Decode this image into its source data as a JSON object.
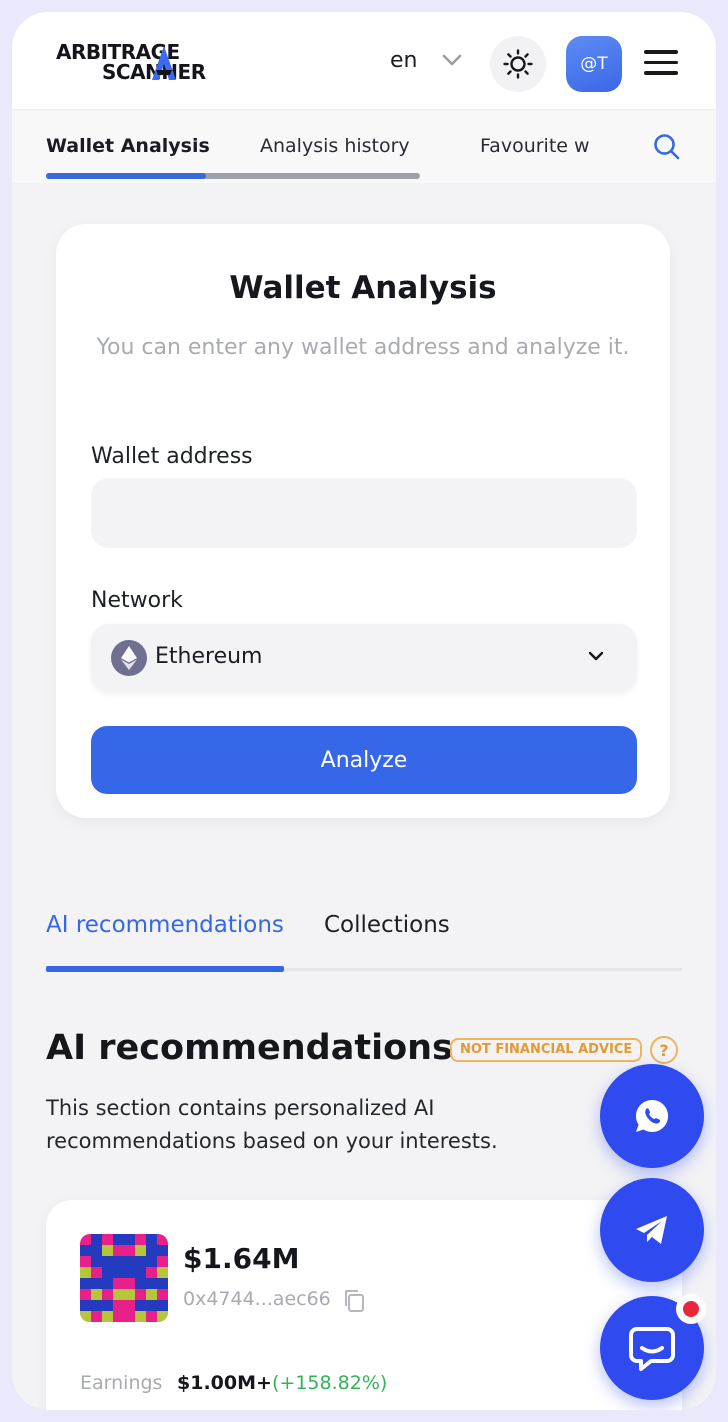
{
  "header": {
    "logo_line1": "ARBITRAGE",
    "logo_line2": "SCANNER",
    "language": "en",
    "avatar_label": "@T"
  },
  "tabs": [
    {
      "label": "Wallet Analysis",
      "active": true
    },
    {
      "label": "Analysis history",
      "active": false
    },
    {
      "label": "Favourite w",
      "active": false
    }
  ],
  "wallet_card": {
    "title": "Wallet Analysis",
    "subtitle": "You can enter any wallet address and analyze it.",
    "address_label": "Wallet address",
    "address_value": "",
    "network_label": "Network",
    "network_value": "Ethereum",
    "analyze_label": "Analyze"
  },
  "section_tabs": [
    {
      "label": "AI recommendations",
      "active": true
    },
    {
      "label": "Collections",
      "active": false
    }
  ],
  "ai_section": {
    "heading": "AI recommendations",
    "badge": "NOT FINANCIAL ADVICE",
    "help": "?",
    "description": "This section contains personalized AI recommendations based on your interests."
  },
  "recommendation": {
    "value": "$1.64M",
    "address": "0x4744...aec66",
    "earnings_label": "Earnings",
    "earnings_value": "$1.00M+",
    "earnings_change": "(+158.82%)"
  },
  "colors": {
    "accent": "#3667e8",
    "fab": "#2f4bf0",
    "positive": "#34b25a",
    "warning": "#e39a33"
  },
  "icons": [
    "logo-mark-icon",
    "chevron-down-icon",
    "sun-icon",
    "menu-icon",
    "search-icon",
    "ethereum-icon",
    "copy-icon",
    "whatsapp-icon",
    "telegram-icon",
    "chat-icon"
  ]
}
